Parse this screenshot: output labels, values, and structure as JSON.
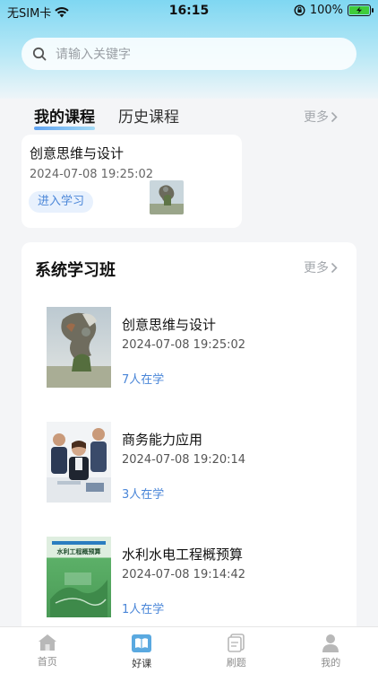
{
  "status_bar": {
    "carrier": "无SIM卡",
    "time": "16:15",
    "battery": "100%"
  },
  "search": {
    "placeholder": "请输入关键字"
  },
  "tabs": {
    "my_courses": "我的课程",
    "history": "历史课程",
    "more": "更多"
  },
  "my_course": {
    "title": "创意思维与设计",
    "date": "2024-07-08 19:25:02",
    "enter_label": "进入学习"
  },
  "system_class": {
    "title": "系统学习班",
    "more": "更多",
    "items": [
      {
        "name": "创意思维与设计",
        "time": "2024-07-08 19:25:02",
        "count": "7人在学"
      },
      {
        "name": "商务能力应用",
        "time": "2024-07-08 19:20:14",
        "count": "3人在学"
      },
      {
        "name": "水利水电工程概预算",
        "time": "2024-07-08 19:14:42",
        "count": "1人在学",
        "cover_title": "水利工程概预算"
      }
    ]
  },
  "tabbar": {
    "items": [
      {
        "label": "首页",
        "icon": "home-icon"
      },
      {
        "label": "好课",
        "icon": "course-icon"
      },
      {
        "label": "刷题",
        "icon": "practice-icon"
      },
      {
        "label": "我的",
        "icon": "profile-icon"
      }
    ],
    "active_index": 1
  },
  "colors": {
    "accent": "#4a86d8",
    "header_gradient_top": "#7fd7f2"
  }
}
